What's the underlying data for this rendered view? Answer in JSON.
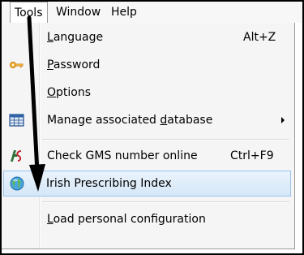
{
  "menubar": {
    "tools": "Tools",
    "window": "Window",
    "help": "Help"
  },
  "menu": {
    "items": [
      {
        "pre": "",
        "u": "L",
        "post": "anguage",
        "shortcut": "Alt+Z",
        "icon": "none"
      },
      {
        "pre": "",
        "u": "P",
        "post": "assword",
        "shortcut": "",
        "icon": "key-icon"
      },
      {
        "pre": "",
        "u": "O",
        "post": "ptions",
        "shortcut": "",
        "icon": "none"
      },
      {
        "pre": "Manage associated ",
        "u": "d",
        "post": "atabase",
        "shortcut": "",
        "icon": "database-grid-icon",
        "has_submenu": true
      },
      {
        "pre": "Check GMS number online",
        "u": "",
        "post": "",
        "shortcut": "Ctrl+F9",
        "icon": "gms-logo-icon"
      },
      {
        "pre": "Irish Prescribing Index",
        "u": "",
        "post": "",
        "shortcut": "",
        "icon": "globe-icon",
        "highlighted": true
      },
      {
        "pre": "",
        "u": "L",
        "post": "oad personal configuration",
        "shortcut": "",
        "icon": "none"
      }
    ]
  },
  "colors": {
    "highlight_border": "#9cc4ea",
    "highlight_fill": "#d5e7f8",
    "menu_background": "#f5f5f5"
  }
}
